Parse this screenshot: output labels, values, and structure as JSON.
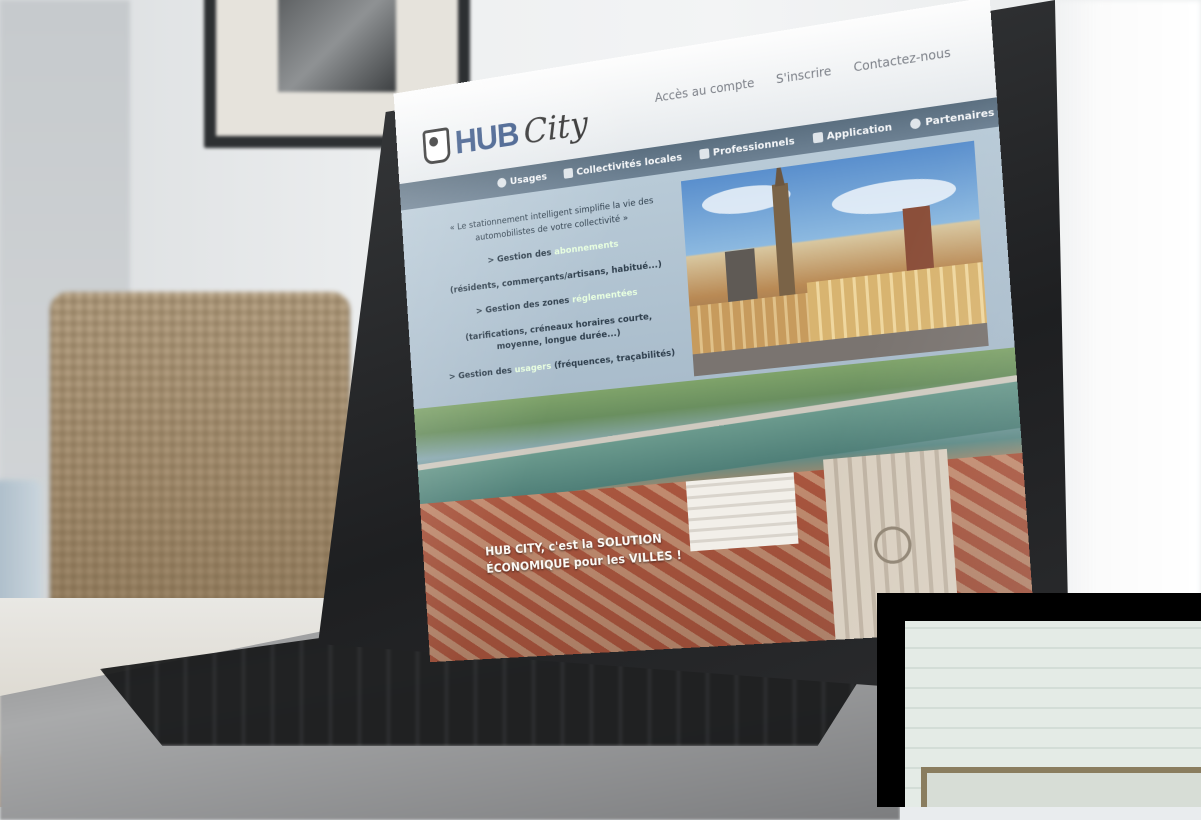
{
  "site": {
    "logo": {
      "hub": "HUB",
      "city": "City"
    },
    "top_links": [
      "Accès au compte",
      "S'inscrire",
      "Contactez-nous"
    ],
    "nav": [
      {
        "label": "Usages",
        "icon": "user-icon"
      },
      {
        "label": "Collectivités locales",
        "icon": "building-icon"
      },
      {
        "label": "Professionnels",
        "icon": "briefcase-icon"
      },
      {
        "label": "Application",
        "icon": "phone-icon"
      },
      {
        "label": "Partenaires",
        "icon": "handshake-icon"
      }
    ],
    "intro": "« Le stationnement intelligent simplifie la vie des automobilistes de votre collectivité »",
    "lines": [
      {
        "prefix": "> Gestion des ",
        "highlight": "abonnements",
        "suffix": ""
      },
      {
        "prefix": "(résidents, commerçants/artisans, habitué...)",
        "highlight": "",
        "suffix": ""
      },
      {
        "prefix": "> Gestion des zones ",
        "highlight": "réglementées",
        "suffix": ""
      },
      {
        "prefix": "(tarifications, créneaux horaires courte, moyenne, ",
        "highlight": "",
        "suffix": "longue durée...)"
      },
      {
        "prefix": "> Gestion des ",
        "highlight": "usagers",
        "suffix": " (fréquences, traçabilités)"
      }
    ],
    "slogan": "HUB CITY, c'est la SOLUTION ÉCONOMIQUE pour les VILLES !"
  },
  "colors": {
    "brand_blue": "#3e5a8a",
    "nav_bg": "#5b6f80",
    "panel_bg": "#b8cad7",
    "highlight": "#e8ffe0"
  }
}
